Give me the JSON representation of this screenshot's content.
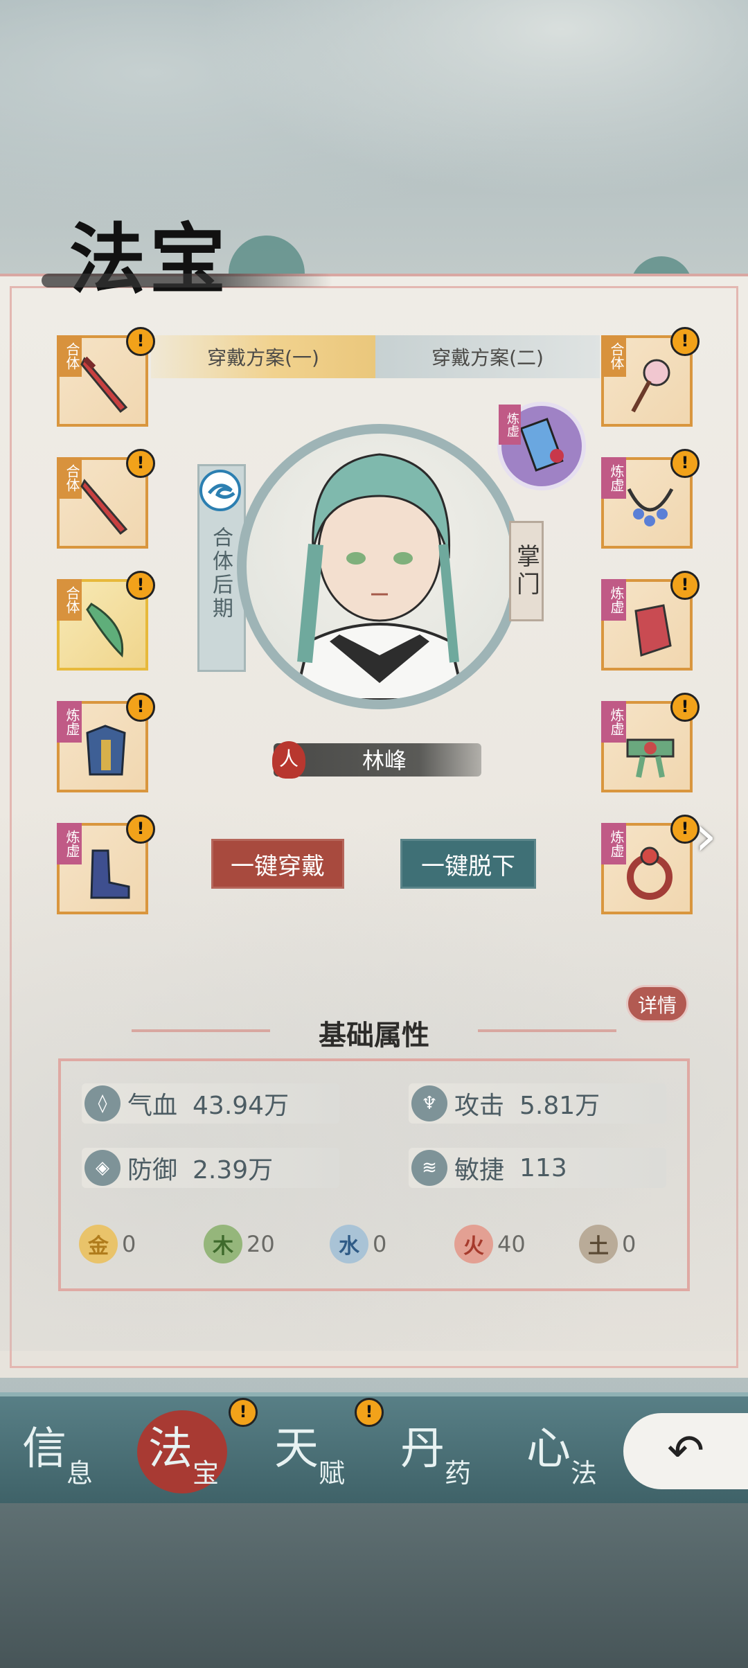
{
  "title": "法宝",
  "plan_tabs": [
    "穿戴方案(一)",
    "穿戴方案(二)"
  ],
  "left_slots": [
    {
      "tag": "合体",
      "tag_type": "ht",
      "item": "sword-icon"
    },
    {
      "tag": "合体",
      "tag_type": "ht",
      "item": "sword-icon"
    },
    {
      "tag": "合体",
      "tag_type": "ht",
      "item": "jade-blade-icon",
      "gold": true
    },
    {
      "tag": "炼虚",
      "tag_type": "lx",
      "item": "armor-icon"
    },
    {
      "tag": "炼虚",
      "tag_type": "lx",
      "item": "boot-icon"
    }
  ],
  "right_slots": [
    {
      "tag": "合体",
      "tag_type": "ht",
      "item": "hairpin-icon"
    },
    {
      "tag": "炼虚",
      "tag_type": "lx",
      "item": "necklace-icon"
    },
    {
      "tag": "炼虚",
      "tag_type": "lx",
      "item": "bracer-icon"
    },
    {
      "tag": "炼虚",
      "tag_type": "lx",
      "item": "belt-icon"
    },
    {
      "tag": "炼虚",
      "tag_type": "lx",
      "item": "ring-icon"
    }
  ],
  "warn_mark": "!",
  "talisman_tag": "炼虚",
  "rank": "合体后期",
  "role": "掌门",
  "race": "人",
  "character_name": "林峰",
  "buttons": {
    "equip": "一键穿戴",
    "unequip": "一键脱下"
  },
  "next_arrow": "›",
  "detail": "详情",
  "section_title": "基础属性",
  "stats": [
    {
      "icon": "blood-icon",
      "glyph": "◊",
      "label": "气血",
      "value": "43.94万"
    },
    {
      "icon": "attack-icon",
      "glyph": "♆",
      "label": "攻击",
      "value": "5.81万"
    },
    {
      "icon": "defense-icon",
      "glyph": "◈",
      "label": "防御",
      "value": "2.39万"
    },
    {
      "icon": "agility-icon",
      "glyph": "≋",
      "label": "敏捷",
      "value": "113"
    }
  ],
  "elements": [
    {
      "char": "金",
      "value": "0",
      "color": "#e9c36a",
      "fg": "#b07c1c"
    },
    {
      "char": "木",
      "value": "20",
      "color": "#95b67b",
      "fg": "#3e6a2c"
    },
    {
      "char": "水",
      "value": "0",
      "color": "#a9c3d6",
      "fg": "#2f5b86"
    },
    {
      "char": "火",
      "value": "40",
      "color": "#e3a093",
      "fg": "#a63a2c"
    },
    {
      "char": "土",
      "value": "0",
      "color": "#b9ab98",
      "fg": "#5b4a34"
    }
  ],
  "nav": [
    {
      "big": "信",
      "small": "息"
    },
    {
      "big": "法",
      "small": "宝"
    },
    {
      "big": "天",
      "small": "赋"
    },
    {
      "big": "丹",
      "small": "药"
    },
    {
      "big": "心",
      "small": "法"
    }
  ],
  "back": "↶",
  "colors": {
    "accent_red": "#a84a3e",
    "accent_teal": "#3f7076",
    "frame_gold": "#d9963e"
  }
}
